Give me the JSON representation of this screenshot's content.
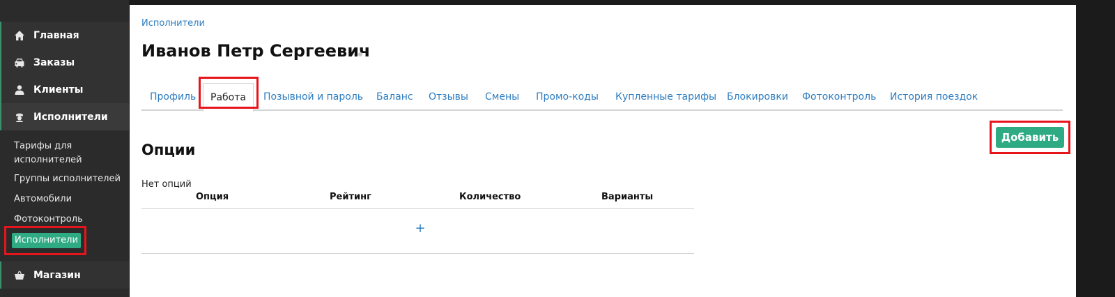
{
  "sidebar": {
    "items": [
      {
        "label": "Главная",
        "icon": "home-icon"
      },
      {
        "label": "Заказы",
        "icon": "car-icon"
      },
      {
        "label": "Клиенты",
        "icon": "user-icon"
      },
      {
        "label": "Исполнители",
        "icon": "driver-icon"
      },
      {
        "label": "Магазин",
        "icon": "basket-icon"
      }
    ],
    "submenu": [
      "Тарифы для исполнителей",
      "Группы исполнителей",
      "Автомобили",
      "Фотоконтроль",
      "Исполнители"
    ]
  },
  "breadcrumb": "Исполнители",
  "page_title": "Иванов Петр Сергеевич",
  "tabs": [
    "Профиль",
    "Работа",
    "Позывной и пароль",
    "Баланс",
    "Отзывы",
    "Смены",
    "Промо-коды",
    "Купленные тарифы",
    "Блокировки",
    "Фотоконтроль",
    "История поездок"
  ],
  "active_tab": "Работа",
  "section": {
    "title": "Опции",
    "add_label": "Добавить",
    "empty_text": "Нет опций",
    "columns": [
      "Опция",
      "Рейтинг",
      "Количество",
      "Варианты"
    ],
    "add_row_label": "+"
  },
  "colors": {
    "accent": "#2eab82",
    "link": "#2e7dc0",
    "highlight": "#e8141c"
  }
}
